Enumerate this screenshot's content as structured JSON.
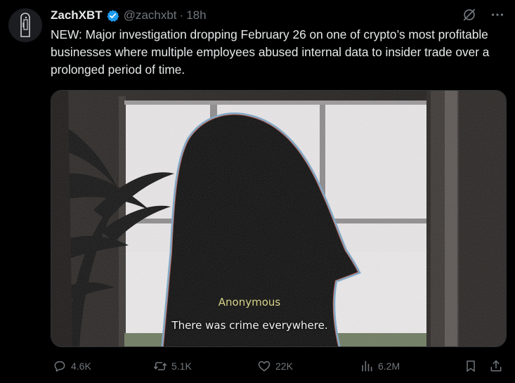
{
  "author": {
    "display_name": "ZachXBT",
    "handle": "@zachxbt",
    "separator": "·",
    "time": "18h"
  },
  "tweet": {
    "text": "NEW: Major investigation dropping February 26 on one of crypto’s most profitable businesses where multiple employees abused internal data to insider trade over a prolonged period of time."
  },
  "media": {
    "caption_name": "Anonymous",
    "caption_line": "There was crime everywhere."
  },
  "actions": {
    "replies": "4.6K",
    "reposts": "5.1K",
    "likes": "22K",
    "views": "6.2M"
  },
  "icons": {
    "verified": "verified-badge-icon",
    "grok": "grok-icon",
    "more": "more-icon",
    "reply": "reply-icon",
    "repost": "repost-icon",
    "like": "like-icon",
    "views": "views-icon",
    "bookmark": "bookmark-icon",
    "share": "share-icon"
  },
  "colors": {
    "background": "#000000",
    "text_primary": "#e7e9ea",
    "text_secondary": "#71767b",
    "verified_blue": "#1d9bf0",
    "caption_name": "#d8d389"
  }
}
